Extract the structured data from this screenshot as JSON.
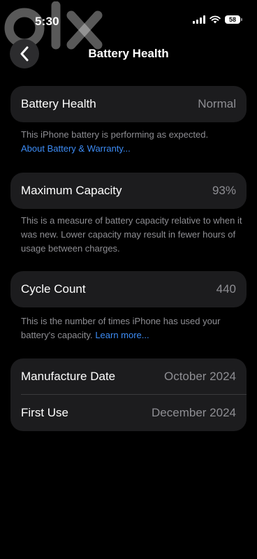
{
  "status_bar": {
    "time": "5:30",
    "battery_level": "58"
  },
  "watermark": {
    "text": "olx"
  },
  "nav": {
    "title": "Battery Health"
  },
  "battery_health": {
    "label": "Battery Health",
    "value": "Normal",
    "footnote": "This iPhone battery is performing as expected.",
    "link": "About Battery & Warranty..."
  },
  "maximum_capacity": {
    "label": "Maximum Capacity",
    "value": "93%",
    "footnote": "This is a measure of battery capacity relative to when it was new. Lower capacity may result in fewer hours of usage between charges."
  },
  "cycle_count": {
    "label": "Cycle Count",
    "value": "440",
    "footnote": "This is the number of times iPhone has used your battery's capacity.",
    "link": "Learn more..."
  },
  "dates": {
    "manufacture_label": "Manufacture Date",
    "manufacture_value": "October 2024",
    "first_use_label": "First Use",
    "first_use_value": "December 2024"
  },
  "colors": {
    "background": "#000000",
    "card": "#1c1c1e",
    "link": "#3d8cf5",
    "secondary_text": "#8e8e93"
  }
}
